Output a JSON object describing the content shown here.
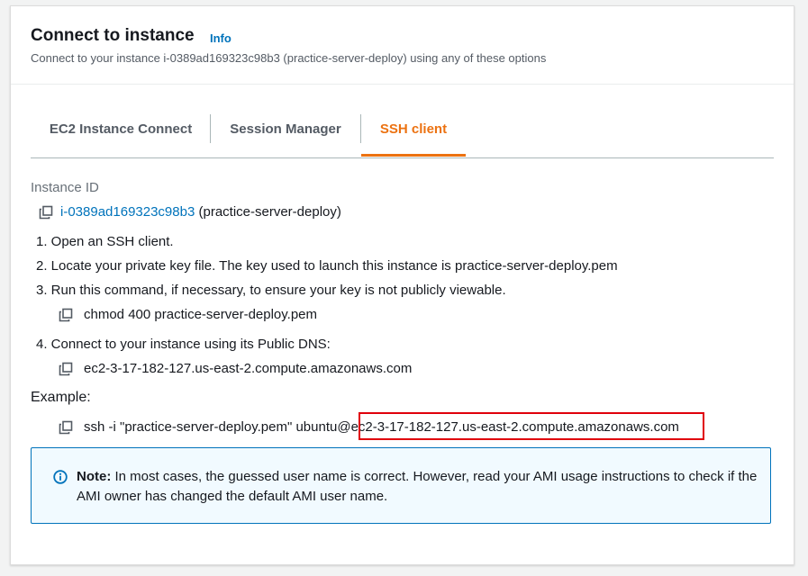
{
  "header": {
    "title": "Connect to instance",
    "info": "Info",
    "subtitle": "Connect to your instance i-0389ad169323c98b3 (practice-server-deploy) using any of these options"
  },
  "tabs": [
    {
      "label": "EC2 Instance Connect"
    },
    {
      "label": "Session Manager"
    },
    {
      "label": "SSH client"
    }
  ],
  "instance": {
    "id_label": "Instance ID",
    "id": "i-0389ad169323c98b3",
    "name": "(practice-server-deploy)"
  },
  "steps": {
    "s1": "1. Open an SSH client.",
    "s2": "2. Locate your private key file. The key used to launch this instance is practice-server-deploy.pem",
    "s3": "3. Run this command, if necessary, to ensure your key is not publicly viewable.",
    "s3_cmd": "chmod 400 practice-server-deploy.pem",
    "s4": "4. Connect to your instance using its Public DNS:",
    "s4_dns": "ec2-3-17-182-127.us-east-2.compute.amazonaws.com"
  },
  "example": {
    "label": "Example:",
    "cmd_prefix": "ssh -i \"practice-server-deploy.pem\" ubuntu@",
    "cmd_host": "ec2-3-17-182-127.us-east-2.compute.amazonaws.com"
  },
  "note": {
    "bold": "Note:",
    "text": " In most cases, the guessed user name is correct. However, read your AMI usage instructions to check if the AMI owner has changed the default AMI user name."
  },
  "colors": {
    "accent": "#ec7211",
    "link": "#0073bb",
    "highlight": "#e0000b"
  }
}
